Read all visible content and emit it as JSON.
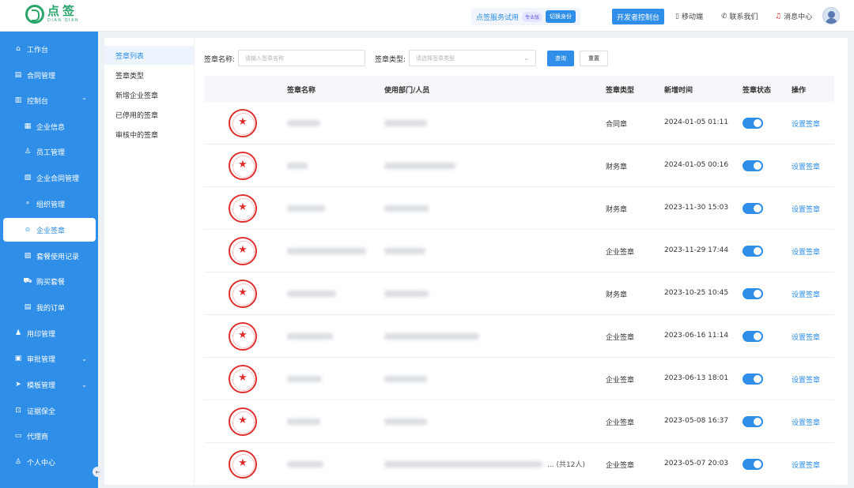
{
  "brand": {
    "name_cn": "点签",
    "name_en": "DIAN QIAN",
    "color": "#2aa66a"
  },
  "header": {
    "trial_text": "点签服务试用",
    "pro_badge": "专业版",
    "switch_label": "切换身份",
    "dev_console": "开发者控制台",
    "mobile": "移动端",
    "contact": "联系我们",
    "messages": "消息中心"
  },
  "accent": "#2e8ee8",
  "sidebar": [
    {
      "label": "工作台",
      "icon": "home-icon",
      "glyph": "⌂"
    },
    {
      "label": "合同管理",
      "icon": "contract-icon",
      "glyph": "▤"
    },
    {
      "label": "控制台",
      "icon": "dashboard-icon",
      "glyph": "▥",
      "chevron": "⌃"
    },
    {
      "label": "企业信息",
      "icon": "company-icon",
      "glyph": "▦",
      "sub": true
    },
    {
      "label": "员工管理",
      "icon": "user-icon",
      "glyph": "♙",
      "sub": true
    },
    {
      "label": "企业合同管理",
      "icon": "doc-icon",
      "glyph": "▧",
      "sub": true
    },
    {
      "label": "组织管理",
      "icon": "org-icon",
      "glyph": "⚬",
      "sub": true
    },
    {
      "label": "企业签章",
      "icon": "seal-icon",
      "glyph": "⍝",
      "sub": true,
      "active": true
    },
    {
      "label": "套餐使用记录",
      "icon": "record-icon",
      "glyph": "▨",
      "sub": true
    },
    {
      "label": "购买套餐",
      "icon": "cart-icon",
      "glyph": "⛟",
      "sub": true
    },
    {
      "label": "我的订单",
      "icon": "order-icon",
      "glyph": "▤",
      "sub": true
    },
    {
      "label": "用印管理",
      "icon": "stamp-icon",
      "glyph": "♟"
    },
    {
      "label": "审批管理",
      "icon": "approve-icon",
      "glyph": "▣",
      "chevron": "⌄"
    },
    {
      "label": "模板管理",
      "icon": "template-icon",
      "glyph": "➤",
      "chevron": "⌄"
    },
    {
      "label": "证据保全",
      "icon": "lock-icon",
      "glyph": "⊡"
    },
    {
      "label": "代理商",
      "icon": "agent-icon",
      "glyph": "▭"
    },
    {
      "label": "个人中心",
      "icon": "person-icon",
      "glyph": "♙"
    }
  ],
  "submenu": [
    {
      "label": "签章列表",
      "active": true
    },
    {
      "label": "签章类型"
    },
    {
      "label": "新增企业签章"
    },
    {
      "label": "已停用的签章"
    },
    {
      "label": "审核中的签章"
    }
  ],
  "filters": {
    "name_label": "签章名称:",
    "name_placeholder": "请输入签章名称",
    "type_label": "签章类型:",
    "type_placeholder": "请选择签章类型",
    "search": "查询",
    "reset": "重置"
  },
  "table": {
    "columns": [
      "签章名称",
      "使用部门/人员",
      "签章类型",
      "新增时间",
      "签章状态",
      "操作"
    ],
    "action_label": "设置签章",
    "rows": [
      {
        "type": "合同章",
        "time": "2024-01-05 01:11",
        "status": true,
        "count": ""
      },
      {
        "type": "财务章",
        "time": "2024-01-05 00:16",
        "status": true,
        "count": ""
      },
      {
        "type": "财务章",
        "time": "2023-11-30 15:03",
        "status": true,
        "count": ""
      },
      {
        "type": "企业签章",
        "time": "2023-11-29 17:44",
        "status": true,
        "count": ""
      },
      {
        "type": "财务章",
        "time": "2023-10-25 10:45",
        "status": true,
        "count": ""
      },
      {
        "type": "企业签章",
        "time": "2023-06-16 11:14",
        "status": true,
        "count": ""
      },
      {
        "type": "企业签章",
        "time": "2023-06-13 18:01",
        "status": true,
        "count": ""
      },
      {
        "type": "企业签章",
        "time": "2023-05-08 16:37",
        "status": true,
        "count": ""
      },
      {
        "type": "企业签章",
        "time": "2023-05-07 20:03",
        "status": true,
        "count": "... (共12人)"
      }
    ]
  }
}
